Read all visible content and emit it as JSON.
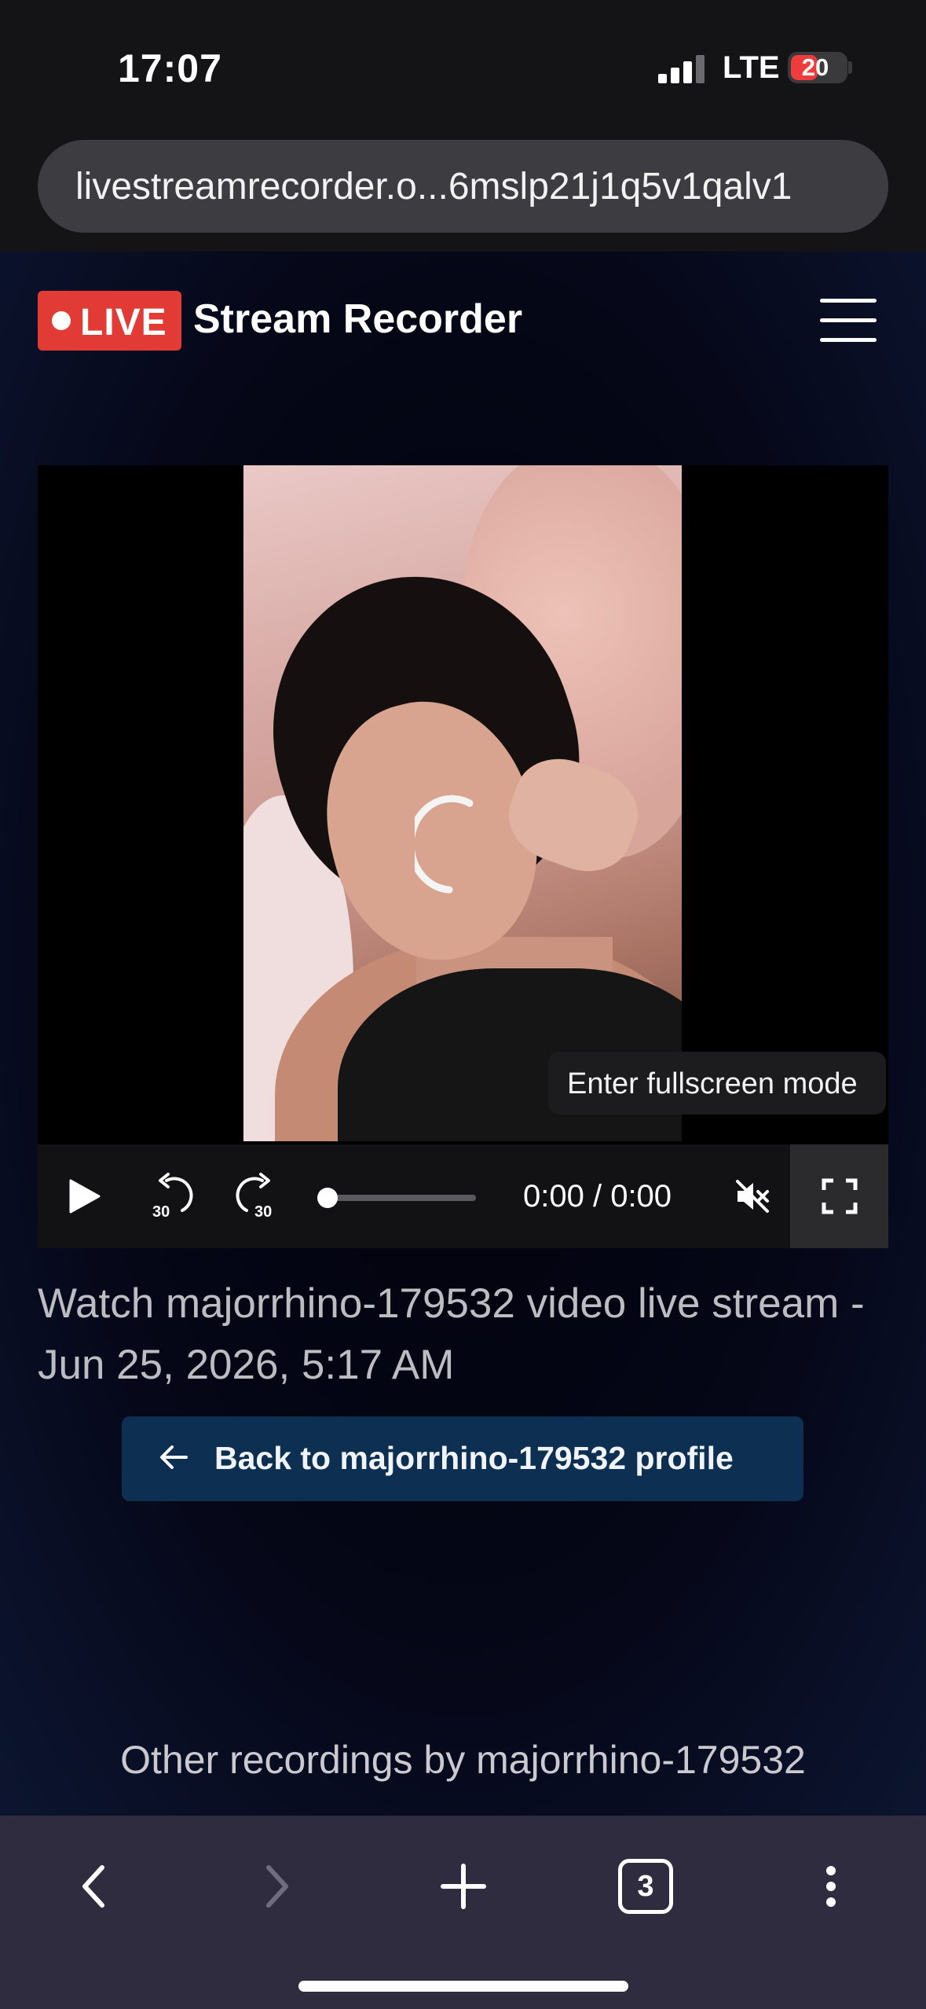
{
  "status_bar": {
    "time": "17:07",
    "network": "LTE",
    "battery": "20"
  },
  "browser": {
    "url": "livestreamrecorder.o...6mslp21j1q5v1qalv1",
    "tab_count": "3"
  },
  "header": {
    "badge": "LIVE",
    "site_title": "Stream Recorder"
  },
  "player": {
    "time_display": "0:00 / 0:00",
    "tooltip": "Enter fullscreen mode",
    "skip_back": "30",
    "skip_forward": "30",
    "progress": 0
  },
  "content": {
    "caption": "Watch majorrhino-179532 video live stream - Jun 25, 2026, 5:17 AM",
    "back_button": "Back to majorrhino-179532 profile",
    "other_recordings_title": "Other recordings by majorrhino-179532"
  },
  "colors": {
    "live_badge": "#e23b36",
    "back_button": "#0c2f52",
    "page_bg": "#050616"
  }
}
